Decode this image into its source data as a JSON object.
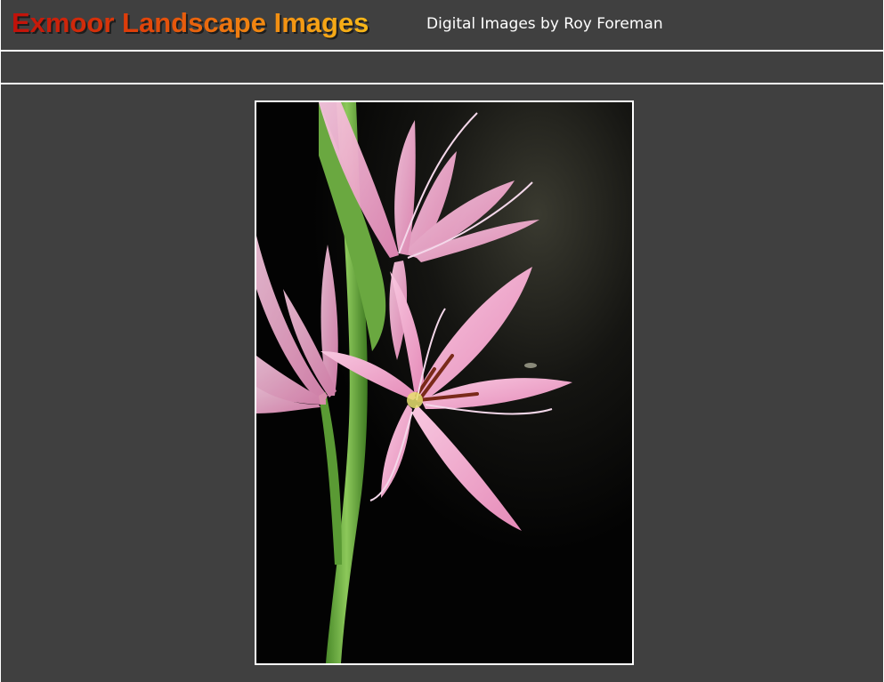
{
  "header": {
    "site_title": "Exmoor Landscape Images",
    "subtitle": "Digital Images by Roy Foreman"
  },
  "photo": {
    "subject": "pink-lily-flower-photo",
    "colors": {
      "petal": "#f0a8cc",
      "stem": "#5ea03a",
      "background": "#050505"
    }
  },
  "colors": {
    "page_background": "#404040",
    "divider": "#ffffff",
    "subtitle_text": "#ffffff",
    "title_gradient_start": "#c0100a",
    "title_gradient_end": "#f8b818"
  }
}
